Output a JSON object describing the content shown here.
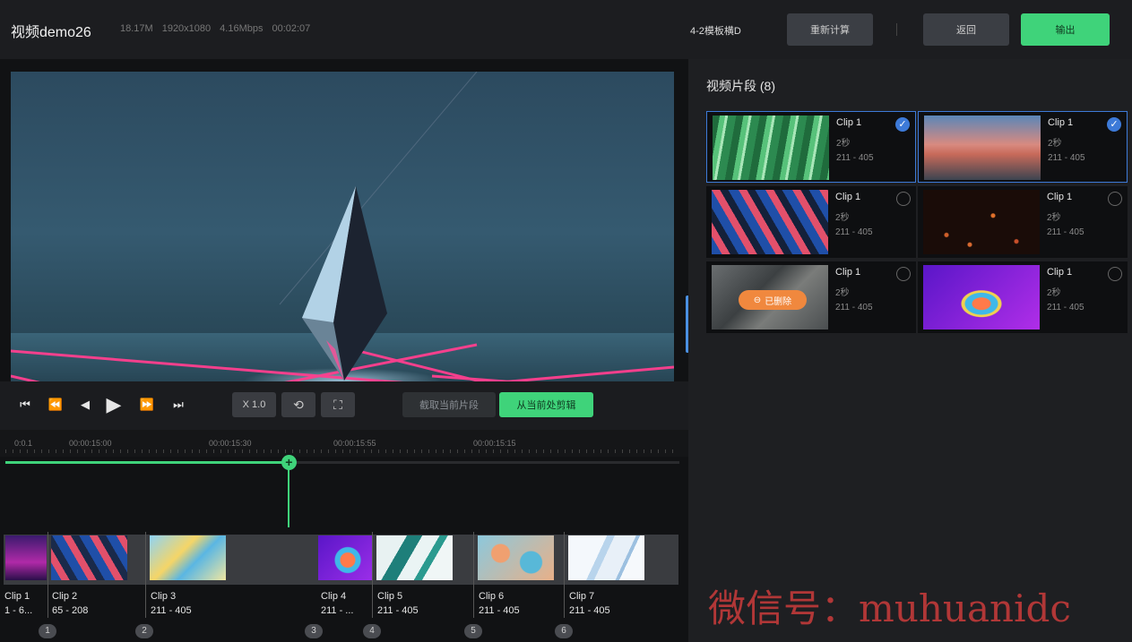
{
  "header": {
    "title": "视频demo26",
    "meta": [
      "18.17M",
      "1920x1080",
      "4.16Mbps",
      "00:02:07"
    ],
    "template": "4-2模板横D",
    "recompute_label": "重新计算",
    "back_label": "返回",
    "export_label": "输出"
  },
  "player": {
    "speed_label": "X 1.0",
    "split_label": "截取当前片段",
    "from_point_label": "从当前处剪辑"
  },
  "ruler": {
    "ticks": [
      "0:0.1",
      "00:00:15:00",
      "00:00:15:30",
      "00:00:15:55",
      "00:00:15:15"
    ]
  },
  "progress": 0.42,
  "timeline": {
    "clips": [
      {
        "name": "Clip 1",
        "range": "1 - 6..."
      },
      {
        "name": "Clip 2",
        "range": "65 - 208"
      },
      {
        "name": "Clip 3",
        "range": "211 - 405"
      },
      {
        "name": "Clip 4",
        "range": "211 - ..."
      },
      {
        "name": "Clip 5",
        "range": "211 - 405"
      },
      {
        "name": "Clip 6",
        "range": "211 - 405"
      },
      {
        "name": "Clip 7",
        "range": "211 - 405"
      }
    ],
    "markers": [
      "1",
      "2",
      "3",
      "4",
      "5",
      "6"
    ]
  },
  "clips_panel": {
    "title": "视频片段 (8)",
    "deleted_label": "已删除",
    "items": [
      {
        "name": "Clip 1",
        "duration": "2秒",
        "range": "211 - 405",
        "selected": true
      },
      {
        "name": "Clip 1",
        "duration": "2秒",
        "range": "211 - 405",
        "selected": true
      },
      {
        "name": "Clip 1",
        "duration": "2秒",
        "range": "211 - 405",
        "selected": false
      },
      {
        "name": "Clip 1",
        "duration": "2秒",
        "range": "211 - 405",
        "selected": false
      },
      {
        "name": "Clip 1",
        "duration": "2秒",
        "range": "211 - 405",
        "selected": false
      },
      {
        "name": "Clip 1",
        "duration": "2秒",
        "range": "211 - 405",
        "selected": false
      }
    ]
  },
  "watermark": "微信号：muhuanidc",
  "colors": {
    "accent": "#3fd37a",
    "select": "#3d7ad8",
    "deleted": "#f0883e"
  }
}
